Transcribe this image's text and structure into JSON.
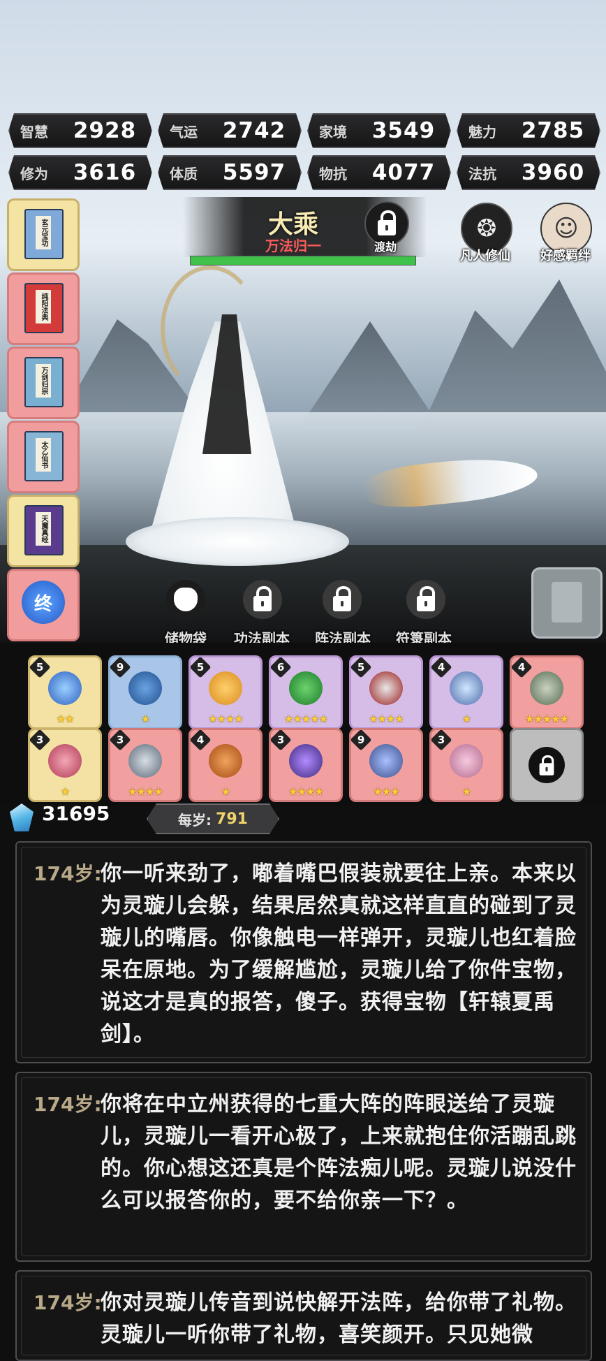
{
  "stats": [
    {
      "label": "智慧",
      "value": "2928"
    },
    {
      "label": "气运",
      "value": "2742"
    },
    {
      "label": "家境",
      "value": "3549"
    },
    {
      "label": "魅力",
      "value": "2785"
    },
    {
      "label": "修为",
      "value": "3616"
    },
    {
      "label": "体质",
      "value": "5597"
    },
    {
      "label": "物抗",
      "value": "4077"
    },
    {
      "label": "法抗",
      "value": "3960"
    }
  ],
  "skills": [
    {
      "title": "玄元宝功",
      "color": "yellow"
    },
    {
      "title": "纯阳法典",
      "color": "red"
    },
    {
      "title": "万剑归宗",
      "color": "red"
    },
    {
      "title": "太乙仙书",
      "color": "red"
    },
    {
      "title": "天魔真经",
      "color": "yellow"
    },
    {
      "title": "终",
      "color": "red"
    }
  ],
  "realm": {
    "name": "大乘",
    "subtitle": "万法归一",
    "hp_fraction": 1.0
  },
  "top_buttons": {
    "tribulation": "渡劫",
    "mortal": "凡人修仙",
    "affinity": "好感羁绊"
  },
  "tabs": [
    "储物袋",
    "功法副本",
    "阵法副本",
    "符箓副本"
  ],
  "items": [
    {
      "level": "5",
      "color": "yellow",
      "stars": "★★",
      "icon": "orb-icon"
    },
    {
      "level": "9",
      "color": "blue",
      "stars": "★",
      "icon": "boots-icon"
    },
    {
      "level": "5",
      "color": "purple",
      "stars": "★★★★",
      "icon": "gourd-icon"
    },
    {
      "level": "6",
      "color": "purple",
      "stars": "★★★★★",
      "icon": "claw-icon"
    },
    {
      "level": "5",
      "color": "purple",
      "stars": "★★★★",
      "icon": "ring-icon"
    },
    {
      "level": "4",
      "color": "purple",
      "stars": "★",
      "icon": "necklace-icon"
    },
    {
      "level": "4",
      "color": "red",
      "stars": "★★★★★",
      "icon": "axe-icon"
    },
    {
      "level": "3",
      "color": "yellow",
      "stars": "★",
      "icon": "cauldron-icon"
    },
    {
      "level": "3",
      "color": "red",
      "stars": "★★★★",
      "icon": "dagger-icon"
    },
    {
      "level": "4",
      "color": "red",
      "stars": "★",
      "icon": "censer-icon"
    },
    {
      "level": "3",
      "color": "red",
      "stars": "★★★★",
      "icon": "mirror-icon"
    },
    {
      "level": "9",
      "color": "red",
      "stars": "★★★",
      "icon": "staff-icon"
    },
    {
      "level": "3",
      "color": "red",
      "stars": "★",
      "icon": "scroll-icon"
    },
    {
      "level": "",
      "color": "gray",
      "stars": "",
      "icon": "lock-icon"
    }
  ],
  "currency": {
    "crystals": "31695",
    "rate_label": "每岁:",
    "rate_value": "791"
  },
  "log": [
    {
      "age": "174岁:",
      "text": "你一听来劲了，嘟着嘴巴假装就要往上亲。本来以为灵璇儿会躲，结果居然真就这样直直的碰到了灵璇儿的嘴唇。你像触电一样弹开，灵璇儿也红着脸呆在原地。为了缓解尴尬，灵璇儿给了你件宝物，说这才是真的报答，傻子。获得宝物【轩辕夏禹剑】。"
    },
    {
      "age": "174岁:",
      "text": "你将在中立州获得的七重大阵的阵眼送给了灵璇儿，灵璇儿一看开心极了，上来就抱住你活蹦乱跳的。你心想这还真是个阵法痴儿呢。灵璇儿说没什么可以报答你的，要不给你亲一下？。"
    },
    {
      "age": "174岁:",
      "text": "你对灵璇儿传音到说快解开法阵，给你带了礼物。灵璇儿一听你带了礼物，喜笑颜开。只见她微"
    }
  ]
}
